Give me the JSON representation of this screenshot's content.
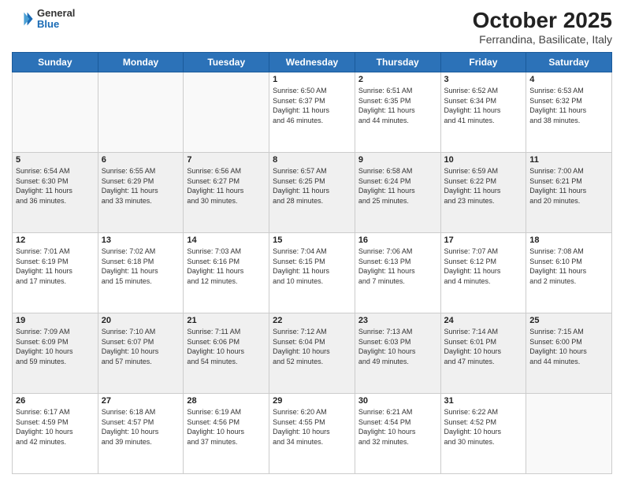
{
  "header": {
    "logo_line1": "General",
    "logo_line2": "Blue",
    "title": "October 2025",
    "subtitle": "Ferrandina, Basilicate, Italy"
  },
  "days_of_week": [
    "Sunday",
    "Monday",
    "Tuesday",
    "Wednesday",
    "Thursday",
    "Friday",
    "Saturday"
  ],
  "weeks": [
    [
      {
        "day": "",
        "info": ""
      },
      {
        "day": "",
        "info": ""
      },
      {
        "day": "",
        "info": ""
      },
      {
        "day": "1",
        "info": "Sunrise: 6:50 AM\nSunset: 6:37 PM\nDaylight: 11 hours\nand 46 minutes."
      },
      {
        "day": "2",
        "info": "Sunrise: 6:51 AM\nSunset: 6:35 PM\nDaylight: 11 hours\nand 44 minutes."
      },
      {
        "day": "3",
        "info": "Sunrise: 6:52 AM\nSunset: 6:34 PM\nDaylight: 11 hours\nand 41 minutes."
      },
      {
        "day": "4",
        "info": "Sunrise: 6:53 AM\nSunset: 6:32 PM\nDaylight: 11 hours\nand 38 minutes."
      }
    ],
    [
      {
        "day": "5",
        "info": "Sunrise: 6:54 AM\nSunset: 6:30 PM\nDaylight: 11 hours\nand 36 minutes."
      },
      {
        "day": "6",
        "info": "Sunrise: 6:55 AM\nSunset: 6:29 PM\nDaylight: 11 hours\nand 33 minutes."
      },
      {
        "day": "7",
        "info": "Sunrise: 6:56 AM\nSunset: 6:27 PM\nDaylight: 11 hours\nand 30 minutes."
      },
      {
        "day": "8",
        "info": "Sunrise: 6:57 AM\nSunset: 6:25 PM\nDaylight: 11 hours\nand 28 minutes."
      },
      {
        "day": "9",
        "info": "Sunrise: 6:58 AM\nSunset: 6:24 PM\nDaylight: 11 hours\nand 25 minutes."
      },
      {
        "day": "10",
        "info": "Sunrise: 6:59 AM\nSunset: 6:22 PM\nDaylight: 11 hours\nand 23 minutes."
      },
      {
        "day": "11",
        "info": "Sunrise: 7:00 AM\nSunset: 6:21 PM\nDaylight: 11 hours\nand 20 minutes."
      }
    ],
    [
      {
        "day": "12",
        "info": "Sunrise: 7:01 AM\nSunset: 6:19 PM\nDaylight: 11 hours\nand 17 minutes."
      },
      {
        "day": "13",
        "info": "Sunrise: 7:02 AM\nSunset: 6:18 PM\nDaylight: 11 hours\nand 15 minutes."
      },
      {
        "day": "14",
        "info": "Sunrise: 7:03 AM\nSunset: 6:16 PM\nDaylight: 11 hours\nand 12 minutes."
      },
      {
        "day": "15",
        "info": "Sunrise: 7:04 AM\nSunset: 6:15 PM\nDaylight: 11 hours\nand 10 minutes."
      },
      {
        "day": "16",
        "info": "Sunrise: 7:06 AM\nSunset: 6:13 PM\nDaylight: 11 hours\nand 7 minutes."
      },
      {
        "day": "17",
        "info": "Sunrise: 7:07 AM\nSunset: 6:12 PM\nDaylight: 11 hours\nand 4 minutes."
      },
      {
        "day": "18",
        "info": "Sunrise: 7:08 AM\nSunset: 6:10 PM\nDaylight: 11 hours\nand 2 minutes."
      }
    ],
    [
      {
        "day": "19",
        "info": "Sunrise: 7:09 AM\nSunset: 6:09 PM\nDaylight: 10 hours\nand 59 minutes."
      },
      {
        "day": "20",
        "info": "Sunrise: 7:10 AM\nSunset: 6:07 PM\nDaylight: 10 hours\nand 57 minutes."
      },
      {
        "day": "21",
        "info": "Sunrise: 7:11 AM\nSunset: 6:06 PM\nDaylight: 10 hours\nand 54 minutes."
      },
      {
        "day": "22",
        "info": "Sunrise: 7:12 AM\nSunset: 6:04 PM\nDaylight: 10 hours\nand 52 minutes."
      },
      {
        "day": "23",
        "info": "Sunrise: 7:13 AM\nSunset: 6:03 PM\nDaylight: 10 hours\nand 49 minutes."
      },
      {
        "day": "24",
        "info": "Sunrise: 7:14 AM\nSunset: 6:01 PM\nDaylight: 10 hours\nand 47 minutes."
      },
      {
        "day": "25",
        "info": "Sunrise: 7:15 AM\nSunset: 6:00 PM\nDaylight: 10 hours\nand 44 minutes."
      }
    ],
    [
      {
        "day": "26",
        "info": "Sunrise: 6:17 AM\nSunset: 4:59 PM\nDaylight: 10 hours\nand 42 minutes."
      },
      {
        "day": "27",
        "info": "Sunrise: 6:18 AM\nSunset: 4:57 PM\nDaylight: 10 hours\nand 39 minutes."
      },
      {
        "day": "28",
        "info": "Sunrise: 6:19 AM\nSunset: 4:56 PM\nDaylight: 10 hours\nand 37 minutes."
      },
      {
        "day": "29",
        "info": "Sunrise: 6:20 AM\nSunset: 4:55 PM\nDaylight: 10 hours\nand 34 minutes."
      },
      {
        "day": "30",
        "info": "Sunrise: 6:21 AM\nSunset: 4:54 PM\nDaylight: 10 hours\nand 32 minutes."
      },
      {
        "day": "31",
        "info": "Sunrise: 6:22 AM\nSunset: 4:52 PM\nDaylight: 10 hours\nand 30 minutes."
      },
      {
        "day": "",
        "info": ""
      }
    ]
  ]
}
